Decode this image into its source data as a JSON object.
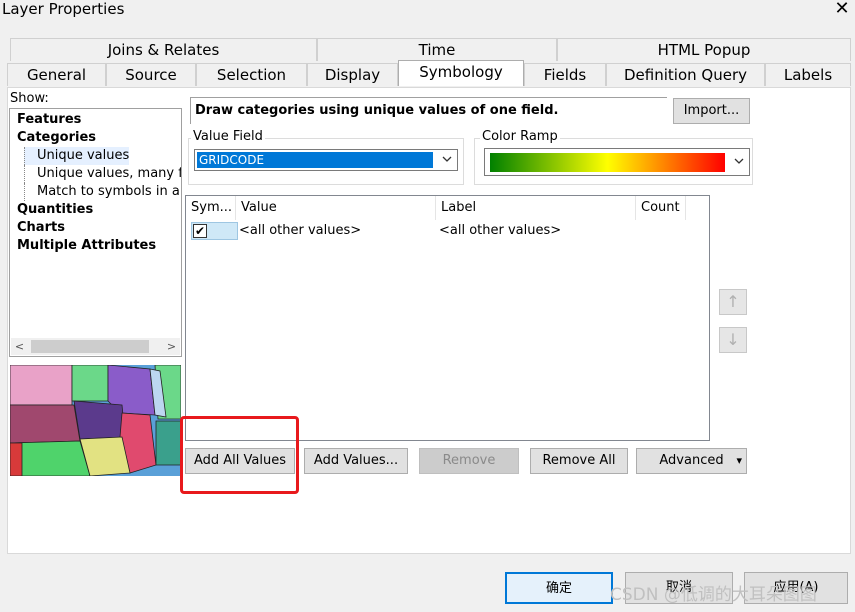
{
  "window": {
    "title": "Layer Properties",
    "close_label": "✕"
  },
  "tabs": {
    "row1": [
      "Joins & Relates",
      "Time",
      "HTML Popup"
    ],
    "row2": [
      "General",
      "Source",
      "Selection",
      "Display",
      "Symbology",
      "Fields",
      "Definition Query",
      "Labels"
    ],
    "active": "Symbology"
  },
  "show": {
    "label": "Show:",
    "items": [
      "Features",
      "Categories",
      "Unique values",
      "Unique values, many fiel",
      "Match to symbols in a sty",
      "Quantities",
      "Charts",
      "Multiple Attributes"
    ],
    "scroll_left": "<",
    "scroll_right": ">"
  },
  "symbology": {
    "description": "Draw categories using unique values of one field.",
    "import_button": "Import...",
    "value_field": {
      "label": "Value Field",
      "value": "GRIDCODE"
    },
    "color_ramp": {
      "label": "Color Ramp",
      "colors": [
        "#008000",
        "#ffff00",
        "#ff0000"
      ]
    }
  },
  "table": {
    "headers": [
      "Sym...",
      "Value",
      "Label",
      "Count"
    ],
    "rows": [
      {
        "checked": "✔",
        "value": "<all other values>",
        "label": "<all other values>",
        "count": ""
      }
    ]
  },
  "buttons": {
    "add_all": "Add All Values",
    "add": "Add Values...",
    "remove": "Remove",
    "remove_all": "Remove All",
    "advanced": "Advanced",
    "advanced_arrow": "▾"
  },
  "move_buttons": {
    "up": "↑",
    "down": "↓"
  },
  "footer": {
    "ok": "确定",
    "cancel": "取消",
    "apply": "应用(A)"
  },
  "watermark": "CSDN @低调的大耳朵图图",
  "colors": {
    "highlight": "#e8191c",
    "selection": "#0078d7",
    "ok_border": "#0078d7"
  }
}
